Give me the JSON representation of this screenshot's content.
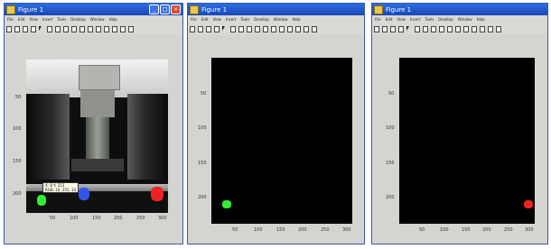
{
  "windows": [
    {
      "title": "Figure 1",
      "menu": [
        "File",
        "Edit",
        "View",
        "Insert",
        "Tools",
        "Desktop",
        "Window",
        "Help"
      ],
      "yticks": [
        "50",
        "100",
        "150",
        "200"
      ],
      "xticks": [
        "50",
        "100",
        "150",
        "200",
        "250",
        "300"
      ],
      "datatip": [
        "X: 8 Y: 213",
        "RGB: 10, 255, 10"
      ]
    },
    {
      "title": "Figure 1",
      "menu": [
        "File",
        "Edit",
        "View",
        "Insert",
        "Tools",
        "Desktop",
        "Window",
        "Help"
      ],
      "yticks": [
        "50",
        "100",
        "150",
        "200"
      ],
      "xticks": [
        "50",
        "100",
        "150",
        "200",
        "250",
        "300"
      ]
    },
    {
      "title": "Figure 1",
      "menu": [
        "File",
        "Edit",
        "View",
        "Insert",
        "Tools",
        "Desktop",
        "Window",
        "Help"
      ],
      "yticks": [
        "50",
        "100",
        "150",
        "200"
      ],
      "xticks": [
        "50",
        "100",
        "150",
        "200",
        "250",
        "300"
      ]
    }
  ],
  "colors": {
    "green_marker": "#33ee33",
    "blue_marker": "#3355ee",
    "red_marker": "#ee2222",
    "axes_background": "#000000"
  }
}
